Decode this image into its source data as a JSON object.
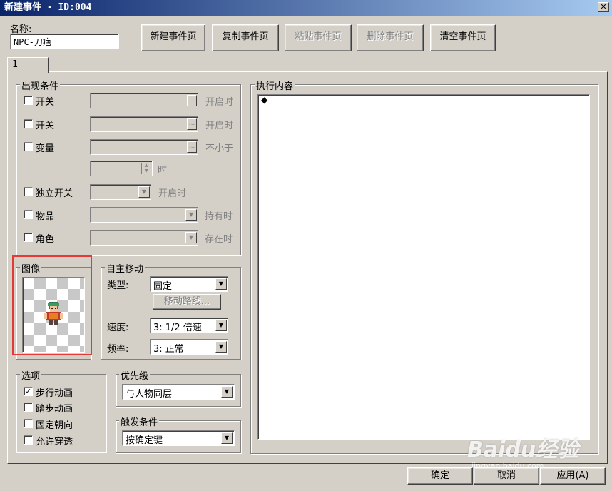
{
  "window": {
    "title": "新建事件 - ID:004",
    "close_glyph": "✕"
  },
  "name": {
    "label": "名称:",
    "value": "NPC-刀疤"
  },
  "page_buttons": {
    "new": "新建事件页",
    "copy": "复制事件页",
    "paste": "粘贴事件页",
    "delete": "删除事件页",
    "clear": "清空事件页"
  },
  "tabs": [
    {
      "label": "1"
    }
  ],
  "conditions": {
    "title": "出现条件",
    "switch1": {
      "label": "开关",
      "suffix": "开启时"
    },
    "switch2": {
      "label": "开关",
      "suffix": "开启时"
    },
    "variable": {
      "label": "变量",
      "suffix": "不小于",
      "time_suffix": "时"
    },
    "self_switch": {
      "label": "独立开关",
      "suffix": "开启时"
    },
    "item": {
      "label": "物品",
      "suffix": "持有时"
    },
    "actor": {
      "label": "角色",
      "suffix": "存在时"
    },
    "ellipsis": "..."
  },
  "image": {
    "title": "图像"
  },
  "autonomous": {
    "title": "自主移动",
    "type_label": "类型:",
    "type_value": "固定",
    "route_button": "移动路线...",
    "speed_label": "速度:",
    "speed_value": "3: 1/2 倍速",
    "freq_label": "频率:",
    "freq_value": "3: 正常"
  },
  "options": {
    "title": "选项",
    "walk_anim": "步行动画",
    "step_anim": "踏步动画",
    "fixed_dir": "固定朝向",
    "through": "允许穿透",
    "check_glyph": "✓"
  },
  "priority": {
    "title": "优先级",
    "value": "与人物同层"
  },
  "trigger": {
    "title": "触发条件",
    "value": "按确定键"
  },
  "contents": {
    "title": "执行内容",
    "bullet": "◆"
  },
  "footer": {
    "ok": "确定",
    "cancel": "取消",
    "apply": "应用(A)"
  },
  "watermark": {
    "text": "Baidu经验",
    "sub": "jingyan.baidu.com"
  },
  "colors": {
    "highlight_box": "#e53935",
    "titlebar": "#0a246a"
  }
}
